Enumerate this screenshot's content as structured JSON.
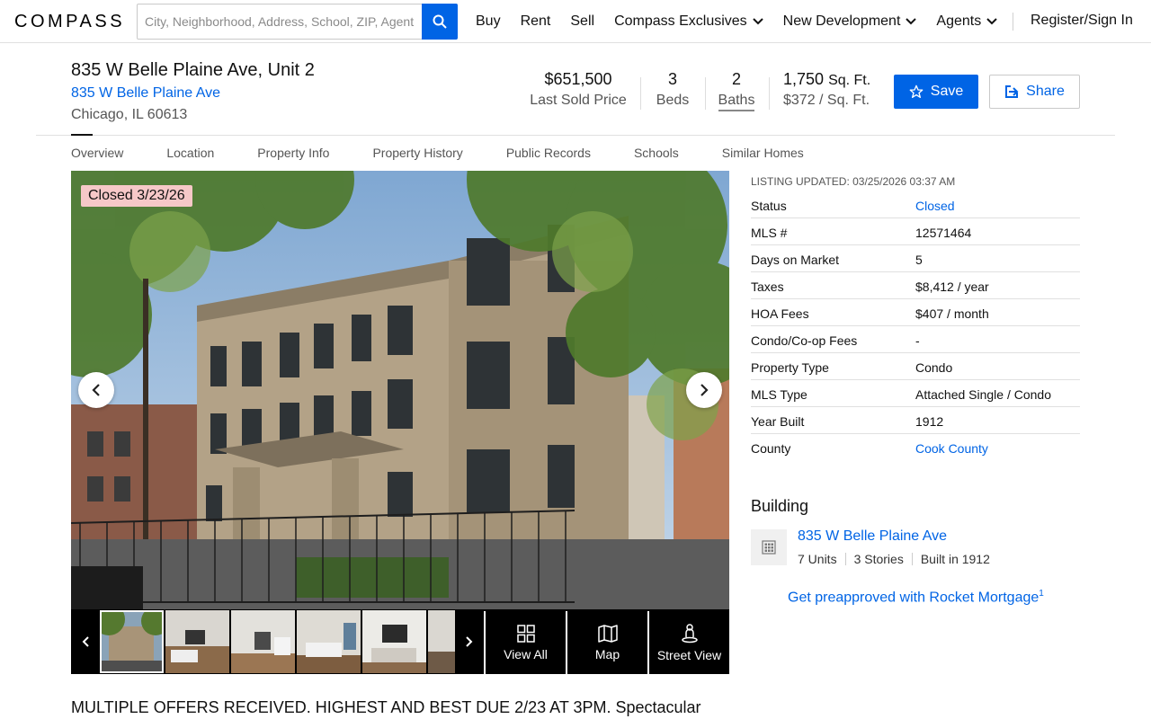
{
  "header": {
    "logo": "COMPASS",
    "search_placeholder": "City, Neighborhood, Address, School, ZIP, Agent",
    "nav": [
      "Buy",
      "Rent",
      "Sell",
      "Compass Exclusives",
      "New Development",
      "Agents"
    ],
    "signin": "Register/Sign In"
  },
  "listing": {
    "title": "835 W Belle Plaine Ave, Unit 2",
    "building_link": "835 W Belle Plaine Ave",
    "city": "Chicago, IL 60613",
    "price": "$651,500",
    "price_label": "Last Sold Price",
    "beds": "3",
    "beds_label": "Beds",
    "baths": "2",
    "baths_label": "Baths",
    "sqft": "1,750",
    "sqft_unit": "Sq. Ft.",
    "price_per_sqft": "$372 / Sq. Ft.",
    "save_label": "Save",
    "share_label": "Share",
    "badge": "Closed 3/23/26"
  },
  "tabs": [
    "Overview",
    "Location",
    "Property Info",
    "Property History",
    "Public Records",
    "Schools",
    "Similar Homes"
  ],
  "media": {
    "view_all": "View All",
    "map": "Map",
    "street_view": "Street View"
  },
  "facts": {
    "updated": "LISTING UPDATED: 03/25/2026 03:37 AM",
    "rows": [
      {
        "k": "Status",
        "v": "Closed"
      },
      {
        "k": "MLS #",
        "v": "12571464"
      },
      {
        "k": "Days on Market",
        "v": "5"
      },
      {
        "k": "Taxes",
        "v": "$8,412 / year"
      },
      {
        "k": "HOA Fees",
        "v": "$407 / month"
      },
      {
        "k": "Condo/Co-op Fees",
        "v": "-"
      },
      {
        "k": "Property Type",
        "v": "Condo"
      },
      {
        "k": "MLS Type",
        "v": "Attached Single / Condo"
      },
      {
        "k": "Year Built",
        "v": "1912"
      },
      {
        "k": "County",
        "v": "Cook County"
      }
    ]
  },
  "building": {
    "heading": "Building",
    "name": "835 W Belle Plaine Ave",
    "units": "7 Units",
    "stories": "3 Stories",
    "built": "Built in 1912"
  },
  "preapproved": "Get preapproved with Rocket Mortgage",
  "preapproved_sup": "1",
  "description": "MULTIPLE OFFERS RECEIVED. HIGHEST AND BEST DUE 2/23 AT 3PM. Spectacular"
}
